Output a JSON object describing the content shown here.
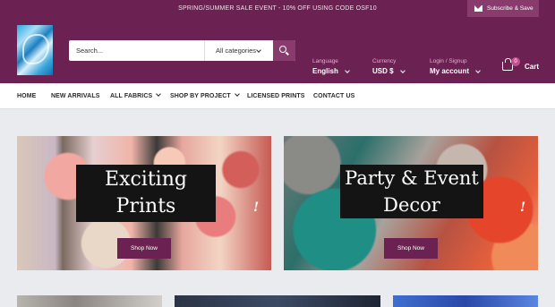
{
  "topbar": {
    "promo": "SPRING/SUMMER SALE EVENT - 10% OFF USING CODE OSF10",
    "subscribe": "Subscribe & Save"
  },
  "header": {
    "search_placeholder": "Search...",
    "categories": "All categories",
    "language": {
      "label": "Language",
      "value": "English"
    },
    "currency": {
      "label": "Currency",
      "value": "USD $"
    },
    "account": {
      "label": "Login / Signup",
      "value": "My account"
    },
    "cart": {
      "count": "0",
      "label": "Cart"
    }
  },
  "nav": {
    "home": "HOME",
    "new_arrivals": "NEW ARRIVALS",
    "all_fabrics": "ALL FABRICS",
    "shop_by_project": "SHOP BY PROJECT",
    "licensed_prints": "LICENSED PRINTS",
    "contact_us": "CONTACT US"
  },
  "banners": [
    {
      "title_line1": "Exciting",
      "title_line2": "Prints",
      "mark": "!",
      "button": "Shop Now"
    },
    {
      "title_line1": "Party & Event",
      "title_line2": "Decor",
      "mark": "!",
      "button": "Shop Now"
    }
  ],
  "colors": {
    "brand": "#6b2252",
    "accent": "#8a3b6d",
    "page_bg": "#e9ebee"
  }
}
